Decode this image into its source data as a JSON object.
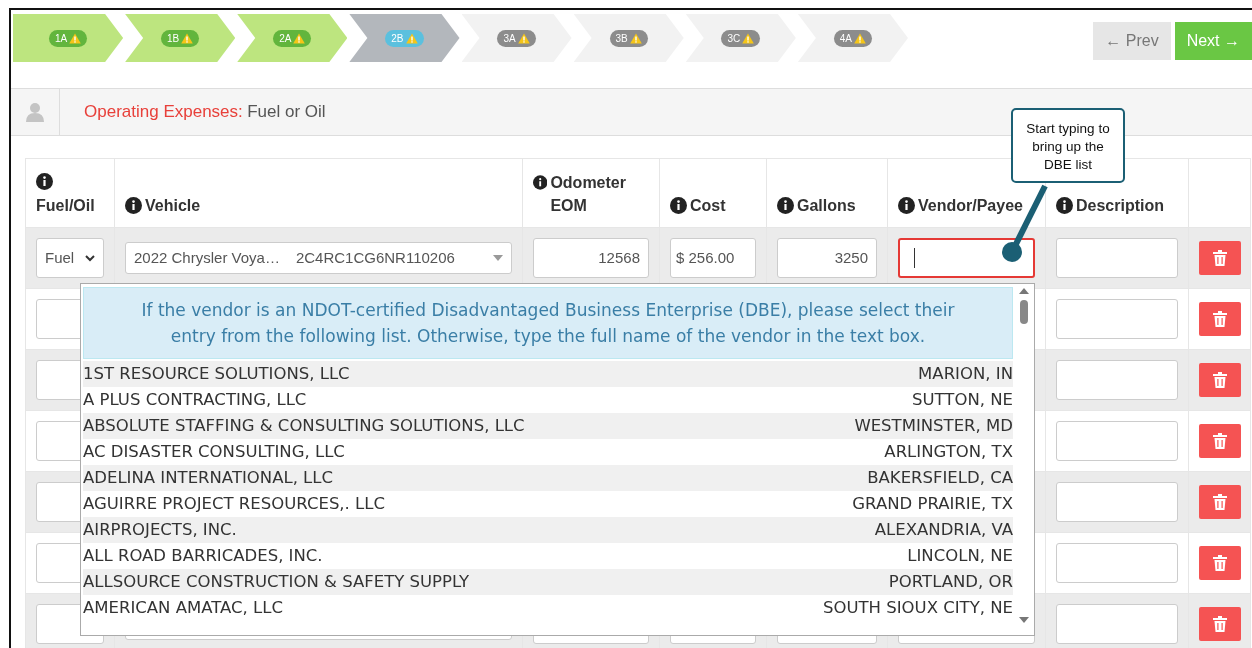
{
  "steps": [
    {
      "label": "1A",
      "completed": true,
      "selected": false,
      "warning": true
    },
    {
      "label": "1B",
      "completed": true,
      "selected": false,
      "warning": true
    },
    {
      "label": "2A",
      "completed": true,
      "selected": false,
      "warning": true
    },
    {
      "label": "2B",
      "completed": false,
      "selected": true,
      "warning": true
    },
    {
      "label": "3A",
      "completed": false,
      "selected": false,
      "warning": true
    },
    {
      "label": "3B",
      "completed": false,
      "selected": false,
      "warning": true
    },
    {
      "label": "3C",
      "completed": false,
      "selected": false,
      "warning": true
    },
    {
      "label": "4A",
      "completed": false,
      "selected": false,
      "warning": true
    }
  ],
  "nav": {
    "prev": "← Prev",
    "next": "Next →"
  },
  "section": {
    "category": "Operating Expenses:",
    "title": "Fuel or Oil"
  },
  "table": {
    "columns": [
      {
        "label": "Fuel/Oil"
      },
      {
        "label": "Vehicle"
      },
      {
        "label": "Odometer EOM"
      },
      {
        "label": "Cost"
      },
      {
        "label": "Gallons"
      },
      {
        "label": "Vendor/Payee"
      },
      {
        "label": "Description"
      }
    ],
    "rows": [
      {
        "kind": "filled",
        "fuel": "Fuel",
        "vehicle_name": "2022 Chrysler Voya…",
        "vehicle_vin": "2C4RC1CG6NR110206",
        "odometer": "12568",
        "cost": "$ 256.00",
        "gallons": "3250",
        "vendor_focused": true
      },
      {
        "kind": "blank"
      },
      {
        "kind": "blank"
      },
      {
        "kind": "blank"
      },
      {
        "kind": "blank"
      },
      {
        "kind": "blank"
      },
      {
        "kind": "blank"
      }
    ]
  },
  "vendor_dropdown": {
    "message": "If the vendor is an NDOT-certified Disadvantaged Business Enterprise (DBE), please select their entry from the following list. Otherwise, type the full name of the vendor in the text box.",
    "options": [
      {
        "name": "1ST RESOURCE SOLUTIONS, LLC",
        "location": "MARION, IN"
      },
      {
        "name": "A PLUS CONTRACTING, LLC",
        "location": "SUTTON, NE"
      },
      {
        "name": "ABSOLUTE STAFFING & CONSULTING SOLUTIONS, LLC",
        "location": "WESTMINSTER, MD"
      },
      {
        "name": "AC DISASTER CONSULTING, LLC",
        "location": "ARLINGTON, TX"
      },
      {
        "name": "ADELINA INTERNATIONAL, LLC",
        "location": "BAKERSFIELD, CA"
      },
      {
        "name": "AGUIRRE PROJECT RESOURCES,. LLC",
        "location": "GRAND PRAIRIE, TX"
      },
      {
        "name": "AIRPROJECTS, INC.",
        "location": "ALEXANDRIA, VA"
      },
      {
        "name": "ALL ROAD BARRICADES, INC.",
        "location": "LINCOLN, NE"
      },
      {
        "name": "ALLSOURCE CONSTRUCTION & SAFETY SUPPLY",
        "location": "PORTLAND, OR"
      },
      {
        "name": "AMERICAN AMATAC, LLC",
        "location": "SOUTH SIOUX CITY, NE"
      }
    ]
  },
  "tooltip": {
    "text": "Start typing to bring up the DBE list"
  }
}
